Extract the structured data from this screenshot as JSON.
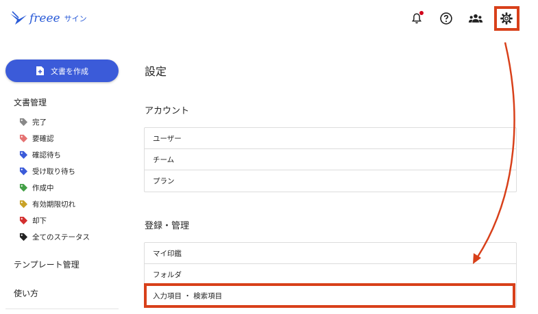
{
  "app": {
    "logo_text": "freee",
    "logo_sub": "サイン"
  },
  "header_icons": [
    "bell-icon",
    "help-icon",
    "team-icon",
    "gear-icon"
  ],
  "sidebar": {
    "create_label": "文書を作成",
    "doc_section": "文書管理",
    "items": [
      {
        "label": "完了",
        "color": "#888888"
      },
      {
        "label": "要確認",
        "color": "#e57373"
      },
      {
        "label": "確認待ち",
        "color": "#3b5bd9"
      },
      {
        "label": "受け取り待ち",
        "color": "#3b5bd9"
      },
      {
        "label": "作成中",
        "color": "#43a047"
      },
      {
        "label": "有効期限切れ",
        "color": "#c9a227"
      },
      {
        "label": "却下",
        "color": "#d32f2f"
      },
      {
        "label": "全てのステータス",
        "color": "#222222"
      }
    ],
    "template_section": "テンプレート管理",
    "howto_section": "使い方"
  },
  "main": {
    "title": "設定",
    "account": {
      "title": "アカウント",
      "rows": [
        "ユーザー",
        "チーム",
        "プラン"
      ]
    },
    "registry": {
      "title": "登録・管理",
      "rows": [
        "マイ印鑑",
        "フォルダ",
        "入力項目 ・ 検索項目"
      ]
    }
  },
  "colors": {
    "accent": "#3b5bd9",
    "highlight": "#d8401a"
  }
}
